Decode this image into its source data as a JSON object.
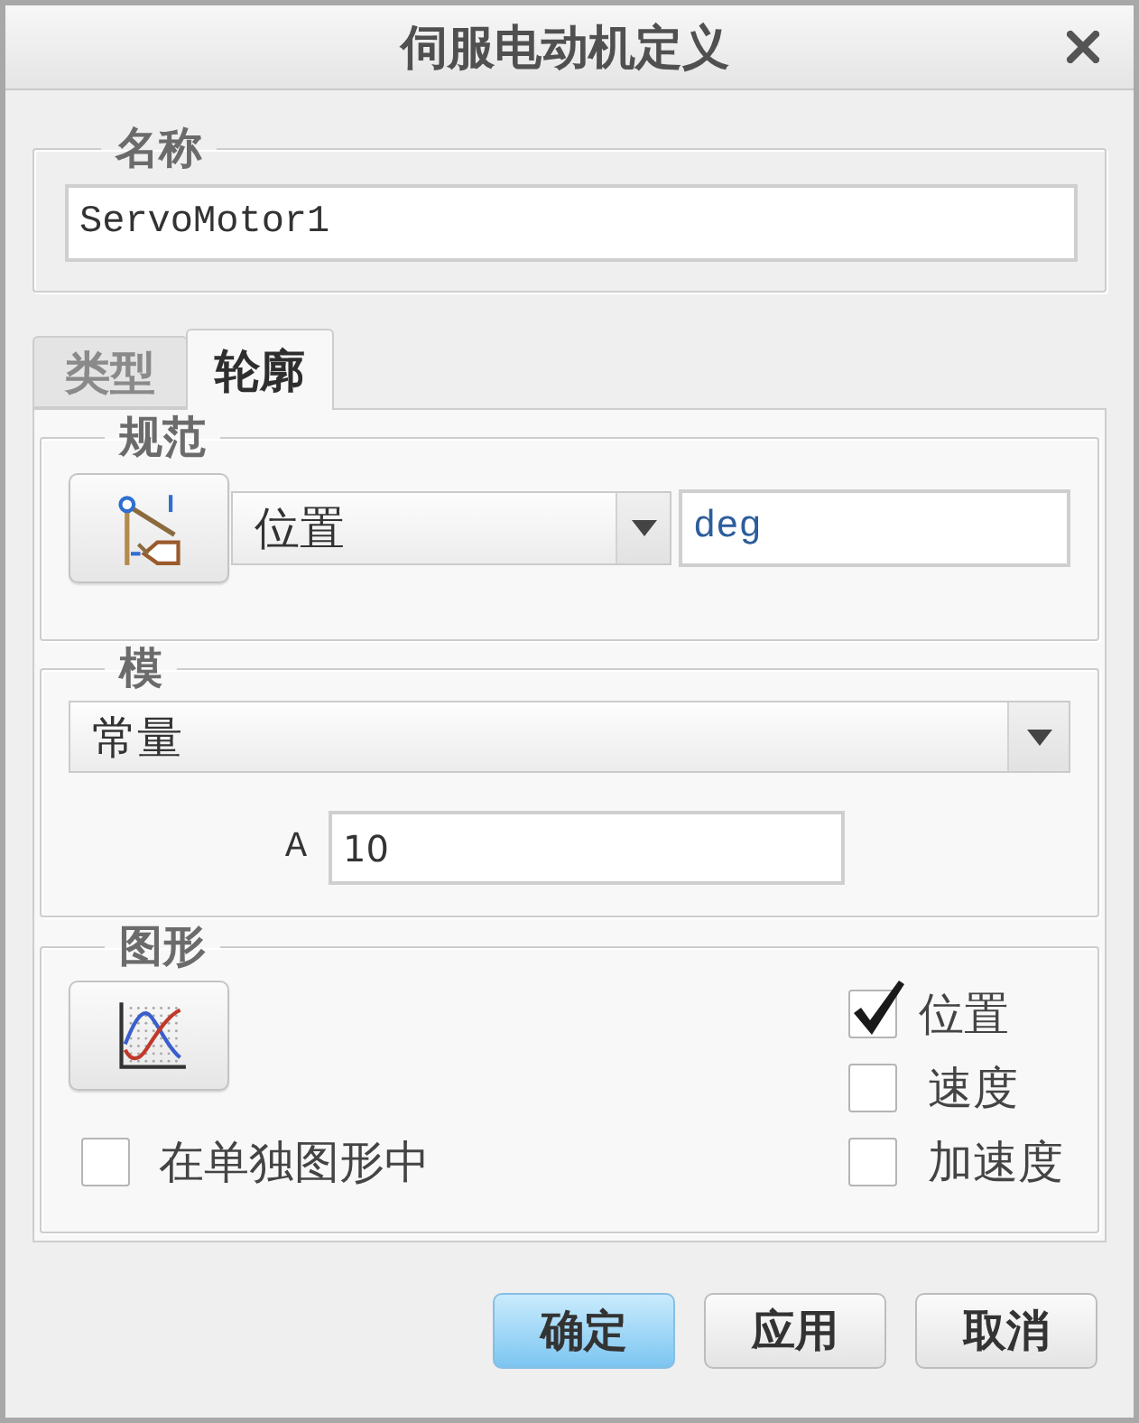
{
  "window": {
    "title": "伺服电动机定义"
  },
  "name_group": {
    "legend": "名称",
    "value": "ServoMotor1"
  },
  "tabs": [
    {
      "label": "类型",
      "selected": false
    },
    {
      "label": "轮廓",
      "selected": true
    }
  ],
  "specification": {
    "legend": "规范",
    "quantity": "位置",
    "unit": "deg"
  },
  "magnitude": {
    "legend": "模",
    "function": "常量",
    "parameters": [
      {
        "label": "A",
        "value": "10"
      }
    ]
  },
  "graph": {
    "legend": "图形",
    "separate_graph": {
      "label": "在单独图形中",
      "checked": false
    },
    "plots": [
      {
        "label": "位置",
        "checked": true
      },
      {
        "label": "速度",
        "checked": false
      },
      {
        "label": "加速度",
        "checked": false
      }
    ]
  },
  "buttons": [
    {
      "label": "确定",
      "default": true
    },
    {
      "label": "应用",
      "default": false
    },
    {
      "label": "取消",
      "default": false
    }
  ]
}
